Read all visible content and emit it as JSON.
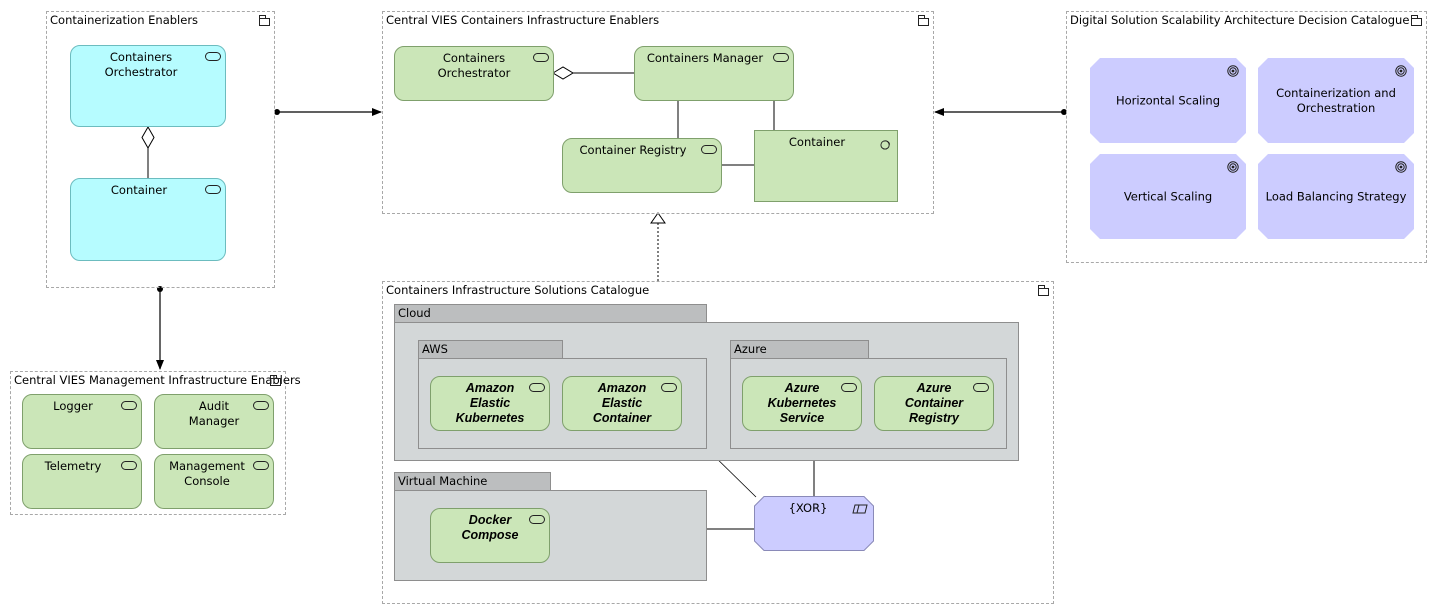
{
  "groups": {
    "containerization_enablers": {
      "title": "Containerization Enablers",
      "elements": [
        "Containers Orchestrator",
        "Container"
      ]
    },
    "central_vies_containers": {
      "title": "Central VIES Containers Infrastructure Enablers",
      "elements": [
        "Containers Orchestrator",
        "Containers Manager",
        "Container Registry",
        "Container"
      ]
    },
    "decision_catalogue": {
      "title": "Digital Solution Scalability Architecture Decision Catalogue",
      "goals": [
        "Horizontal Scaling",
        "Containerization and Orchestration",
        "Vertical Scaling",
        "Load Balancing Strategy"
      ]
    },
    "management_enablers": {
      "title": "Central VIES Management Infrastructure Enablers",
      "elements": [
        "Logger",
        "Audit Manager",
        "Telemetry",
        "Management Console"
      ]
    },
    "solutions_catalogue": {
      "title": "Containers Infrastructure Solutions Catalogue",
      "locations": {
        "cloud": "Cloud",
        "aws": "AWS",
        "azure": "Azure",
        "vm": "Virtual Machine"
      },
      "services": {
        "eks": "Amazon Elastic Kubernetes",
        "ecr": "Amazon Elastic Container",
        "aks": "Azure Kubernetes Service",
        "acr": "Azure Container Registry",
        "docker": "Docker Compose"
      },
      "junction": "{XOR}"
    }
  },
  "colors": {
    "application_service": "#cbe6b8",
    "technology_service": "#b6fcff",
    "goal": "#ccccff",
    "location_body": "#d3d7d8",
    "location_tab": "#bcbebf"
  }
}
